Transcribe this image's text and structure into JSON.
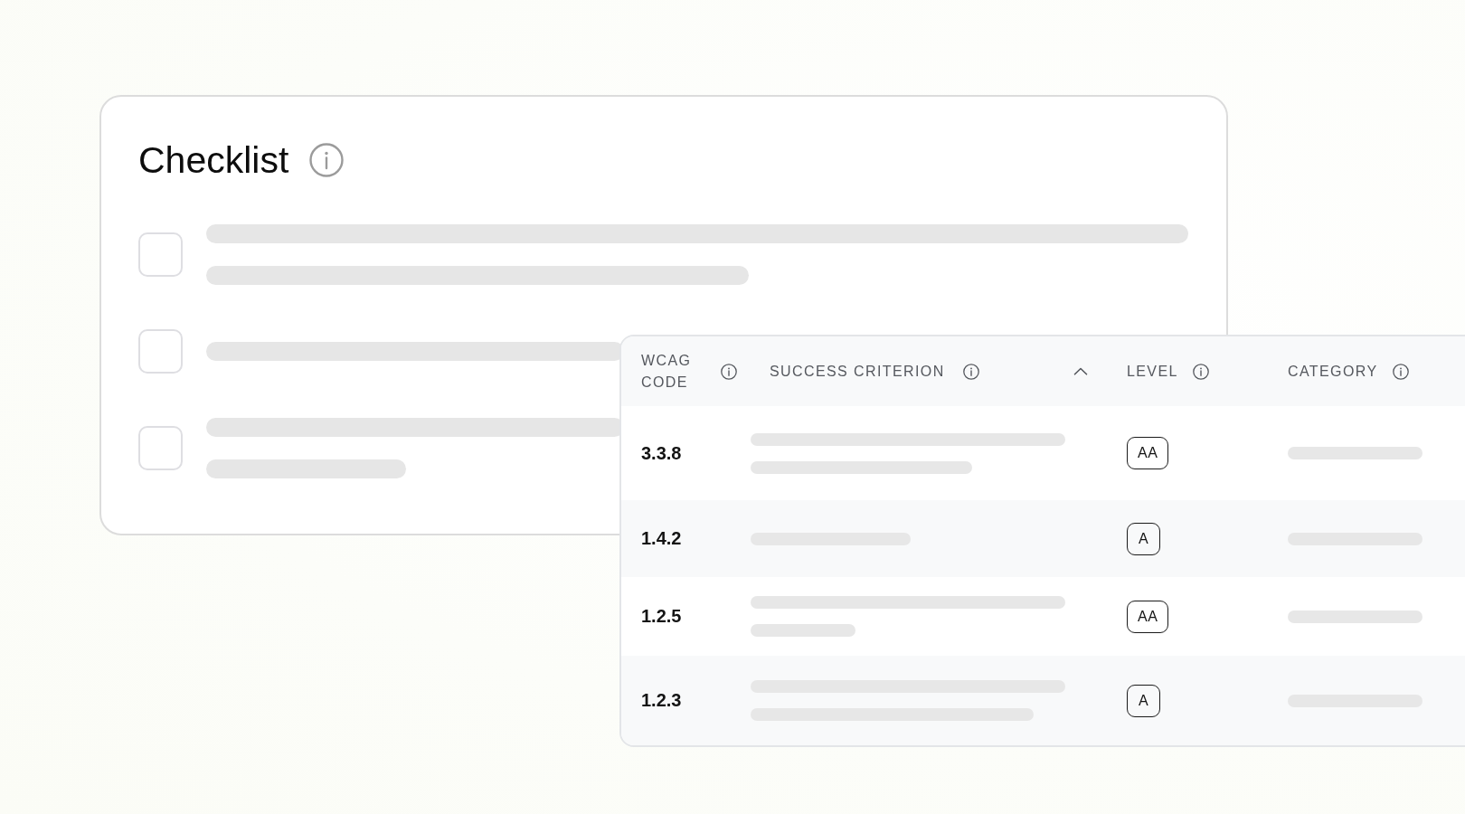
{
  "checklist": {
    "title": "Checklist",
    "items": [
      {
        "checked": false
      },
      {
        "checked": false
      },
      {
        "checked": false
      }
    ]
  },
  "table": {
    "columns": [
      {
        "label": "WCAG CODE",
        "sorted": false
      },
      {
        "label": "SUCCESS CRITERION",
        "sorted": true
      },
      {
        "label": "LEVEL",
        "sorted": false
      },
      {
        "label": "CATEGORY",
        "sorted": false
      }
    ],
    "rows": [
      {
        "wcag_code": "3.3.8",
        "wcag_level": "AA"
      },
      {
        "wcag_code": "1.4.2",
        "wcag_level": "A"
      },
      {
        "wcag_code": "1.2.5",
        "wcag_level": "AA"
      },
      {
        "wcag_code": "1.2.3",
        "wcag_level": "A"
      }
    ]
  }
}
